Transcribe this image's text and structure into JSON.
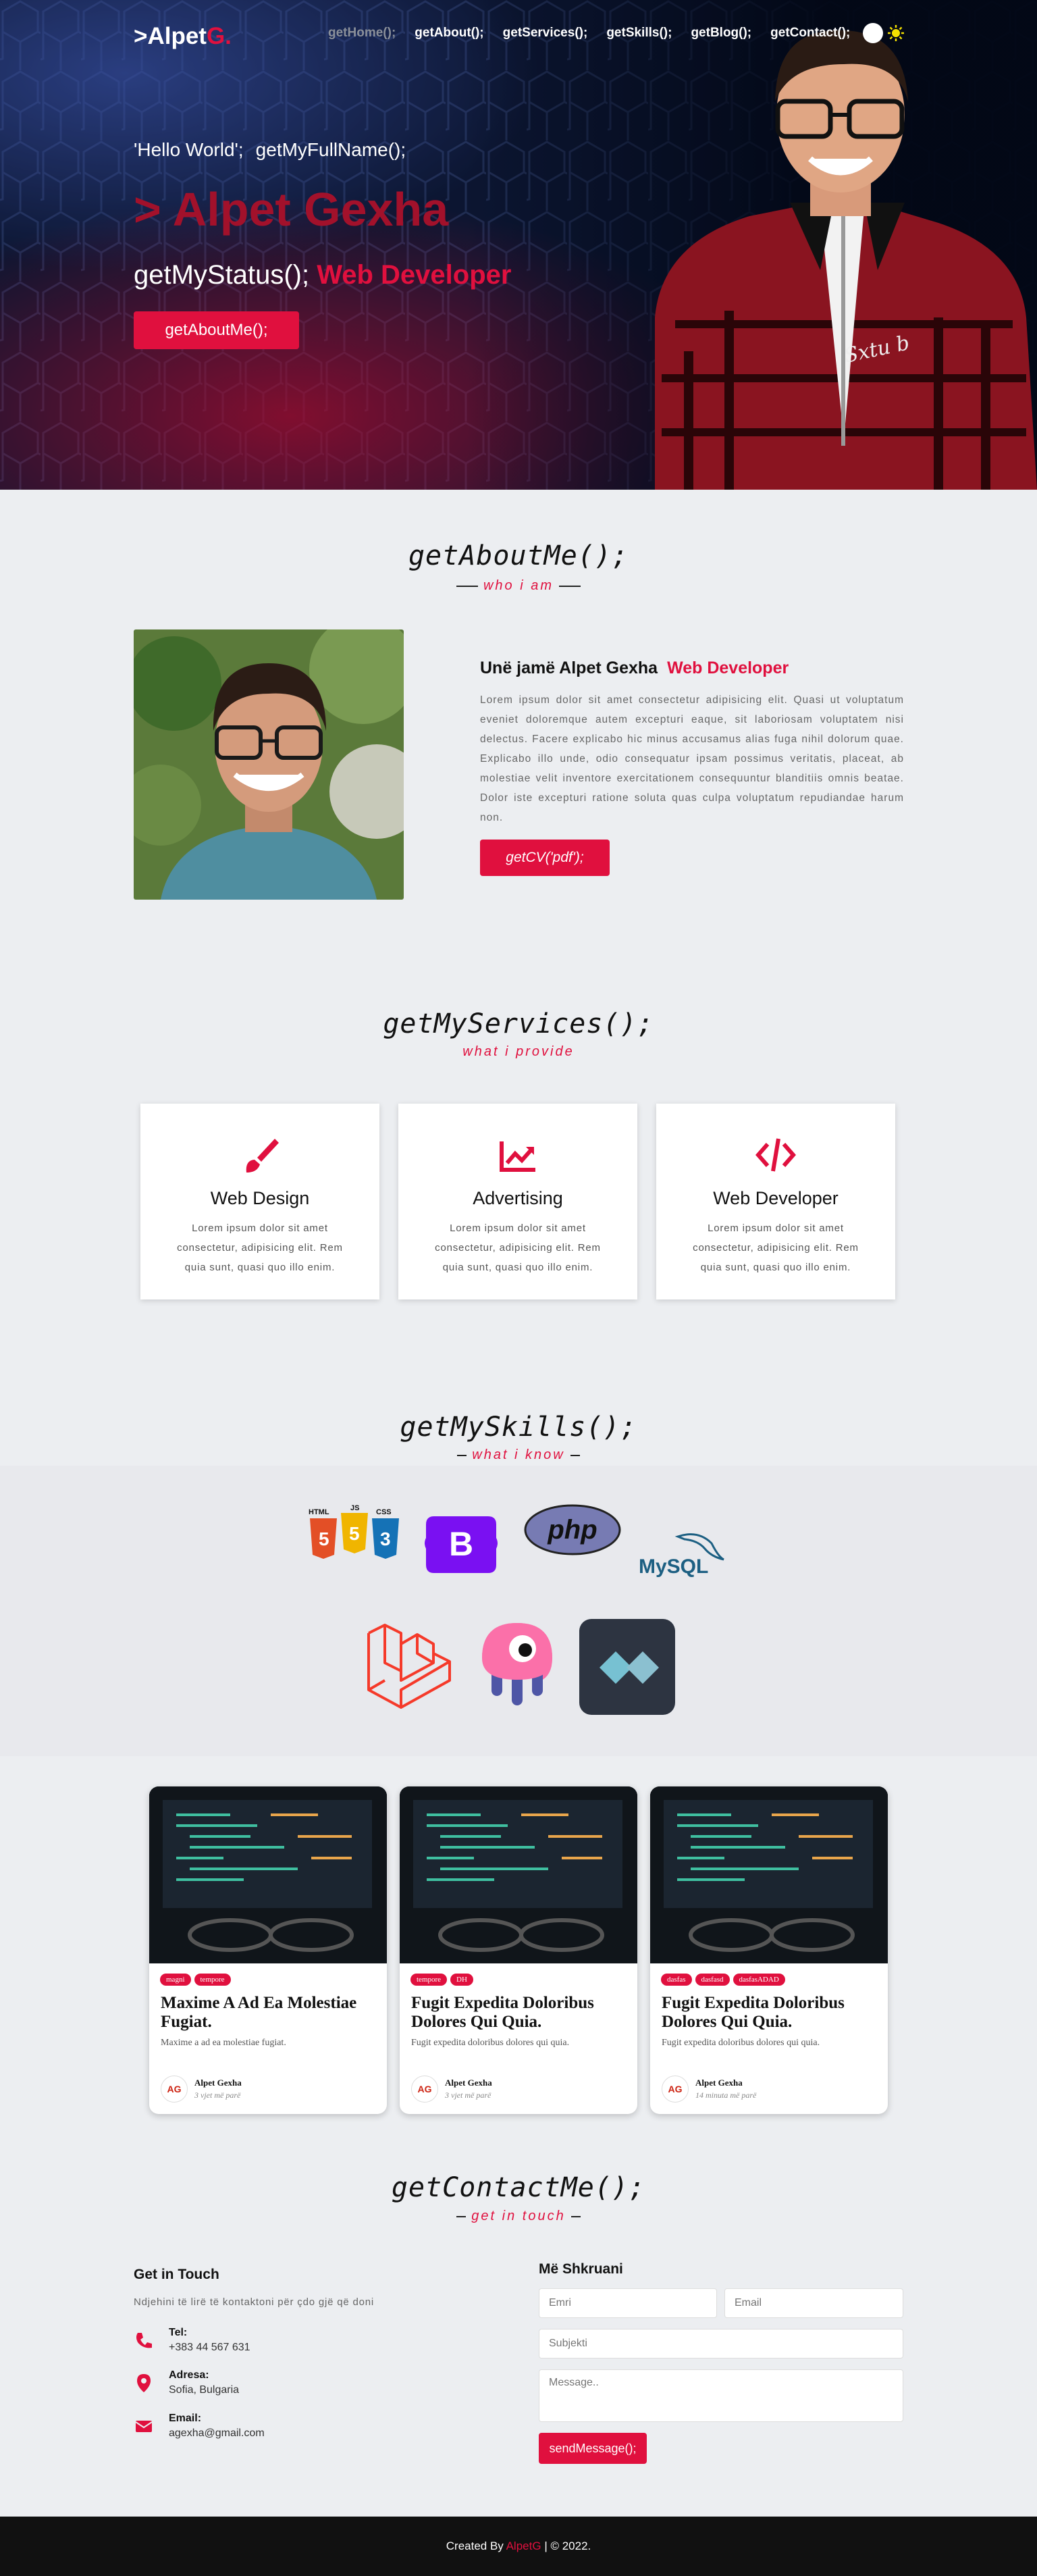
{
  "nav": {
    "logo_prefix": ">Alpet",
    "logo_suffix": "G.",
    "links": [
      "getHome();",
      "getAbout();",
      "getServices();",
      "getSkills();",
      "getBlog();",
      "getContact();"
    ]
  },
  "hero": {
    "hello": "'Hello World';",
    "getname": "getMyFullName();",
    "name": "> Alpet Gexha",
    "status_prefix": "getMyStatus();",
    "status_role": "Web Developer",
    "button": "getAboutMe();",
    "signature": "Sxtu b"
  },
  "about": {
    "title": "getAboutMe();",
    "subtitle": "who i am",
    "heading": "Unë jamë Alpet Gexha",
    "role": "Web Developer",
    "text": "Lorem ipsum dolor sit amet consectetur adipisicing elit. Quasi ut voluptatum eveniet doloremque autem excepturi eaque, sit laboriosam voluptatem nisi delectus. Facere explicabo hic minus accusamus alias fuga nihil dolorum quae. Explicabo illo unde, odio consequatur ipsam possimus veritatis, placeat, ab molestiae velit inventore exercitationem consequuntur blanditiis omnis beatae. Dolor iste excepturi ratione soluta quas culpa voluptatum repudiandae harum non.",
    "cv_button": "getCV('pdf');"
  },
  "services": {
    "title": "getMyServices();",
    "subtitle": "what i provide",
    "items": [
      {
        "name": "Web Design",
        "icon": "brush-icon",
        "text": "Lorem ipsum dolor sit amet consectetur, adipisicing elit. Rem quia sunt, quasi quo illo enim."
      },
      {
        "name": "Advertising",
        "icon": "chart-line-icon",
        "text": "Lorem ipsum dolor sit amet consectetur, adipisicing elit. Rem quia sunt, quasi quo illo enim."
      },
      {
        "name": "Web Developer",
        "icon": "code-icon",
        "text": "Lorem ipsum dolor sit amet consectetur, adipisicing elit. Rem quia sunt, quasi quo illo enim."
      }
    ]
  },
  "skills": {
    "title": "getMySkills();",
    "subtitle": "what i know",
    "logos": {
      "html": "HTML",
      "js": "JS",
      "css": "CSS",
      "bootstrap": "B",
      "php": "php",
      "mysql": "MySQL"
    }
  },
  "blog": {
    "posts": [
      {
        "tags": [
          "magni",
          "tempore"
        ],
        "title": "Maxime A Ad Ea Molestiae Fugiat.",
        "desc": "Maxime a ad ea molestiae fugiat.",
        "author": "Alpet Gexha",
        "time": "3 vjet më parë"
      },
      {
        "tags": [
          "tempore",
          "DH"
        ],
        "title": "Fugit Expedita Doloribus Dolores Qui Quia.",
        "desc": "Fugit expedita doloribus dolores qui quia.",
        "author": "Alpet Gexha",
        "time": "3 vjet më parë"
      },
      {
        "tags": [
          "dasfas",
          "dasfasd",
          "dasfasADAD"
        ],
        "title": "Fugit Expedita Doloribus Dolores Qui Quia.",
        "desc": "Fugit expedita doloribus dolores qui quia.",
        "author": "Alpet Gexha",
        "time": "14 minuta më parë"
      }
    ]
  },
  "contact": {
    "title": "getContactMe();",
    "subtitle": "get in touch",
    "heading": "Get in Touch",
    "sub": "Ndjehini të lirë të kontaktoni për çdo gjë që doni",
    "tel_label": "Tel:",
    "tel": "+383 44 567 631",
    "addr_label": "Adresa:",
    "addr": "Sofia, Bulgaria",
    "email_label": "Email:",
    "email": "agexha@gmail.com",
    "form_heading": "Më Shkruani",
    "ph_name": "Emri",
    "ph_email": "Email",
    "ph_subject": "Subjekti",
    "ph_message": "Message..",
    "send": "sendMessage();"
  },
  "footer": {
    "prefix": "Created By",
    "brand": "AlpetG",
    "suffix": "| © 2022."
  }
}
